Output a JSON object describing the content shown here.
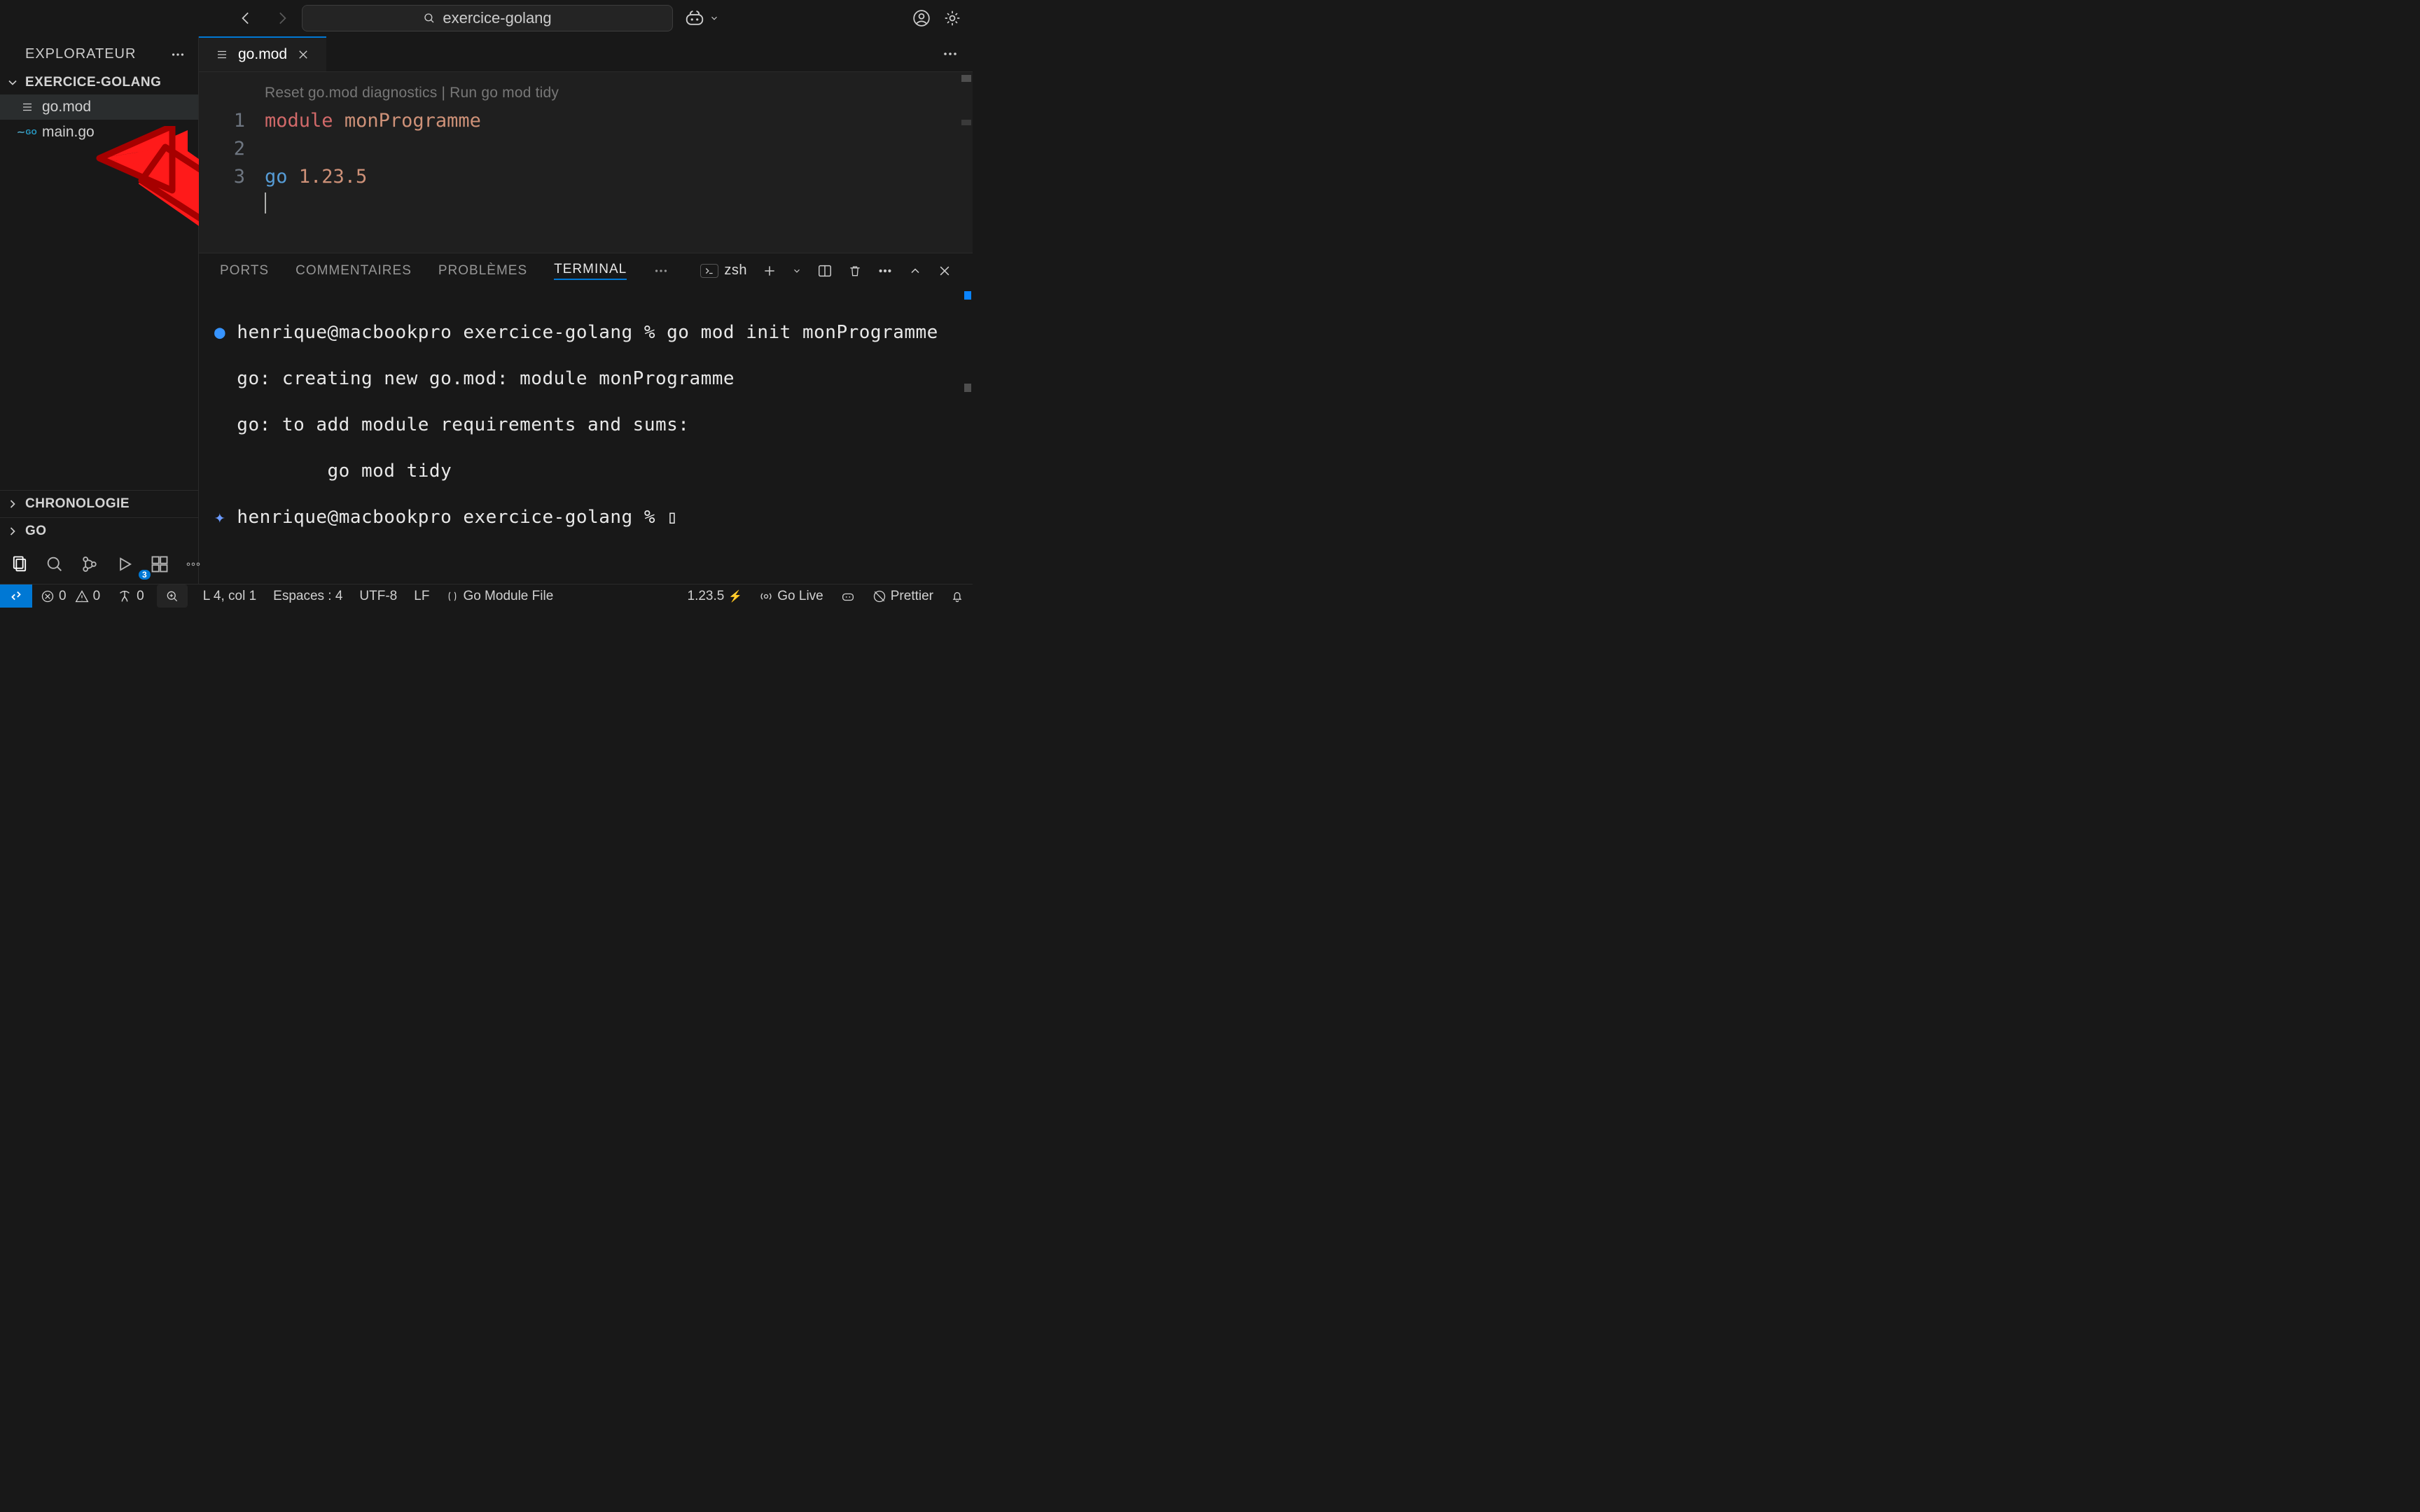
{
  "titlebar": {
    "search_text": "exercice-golang"
  },
  "explorer": {
    "title": "EXPLORATEUR",
    "folder": "EXERCICE-GOLANG",
    "files": [
      {
        "name": "go.mod",
        "icon": "list",
        "active": true
      },
      {
        "name": "main.go",
        "icon": "go",
        "active": false
      }
    ],
    "sections": [
      "CHRONOLOGIE",
      "GO"
    ],
    "ext_badge": "3"
  },
  "tab": {
    "name": "go.mod"
  },
  "codelens": {
    "left": "Reset go.mod diagnostics",
    "sep": " | ",
    "right": "Run go mod tidy"
  },
  "code": {
    "l1_kw": "module",
    "l1_sp": " ",
    "l1_id": "monProgramme",
    "l3_kw": "go",
    "l3_sp": " ",
    "l3_v": "1.23.5",
    "ln1": "1",
    "ln2": "2",
    "ln3": "3"
  },
  "panel": {
    "tabs": [
      "PORTS",
      "COMMENTAIRES",
      "PROBLÈMES",
      "TERMINAL"
    ],
    "shell": "zsh"
  },
  "terminal": {
    "line1_prefix": "● ",
    "line1": "henrique@macbookpro exercice-golang % go mod init monProgramme",
    "line2": "  go: creating new go.mod: module monProgramme",
    "line3": "  go: to add module requirements and sums:",
    "line4": "          go mod tidy",
    "line5_prefix": "✦ ",
    "line5": "henrique@macbookpro exercice-golang % ▯"
  },
  "status": {
    "errors": "0",
    "warnings": "0",
    "ports": "0",
    "cursor": "L 4, col 1",
    "spaces": "Espaces : 4",
    "encoding": "UTF-8",
    "eol": "LF",
    "lang": "Go Module File",
    "go_version": "1.23.5",
    "golive": "Go Live",
    "prettier": "Prettier"
  }
}
